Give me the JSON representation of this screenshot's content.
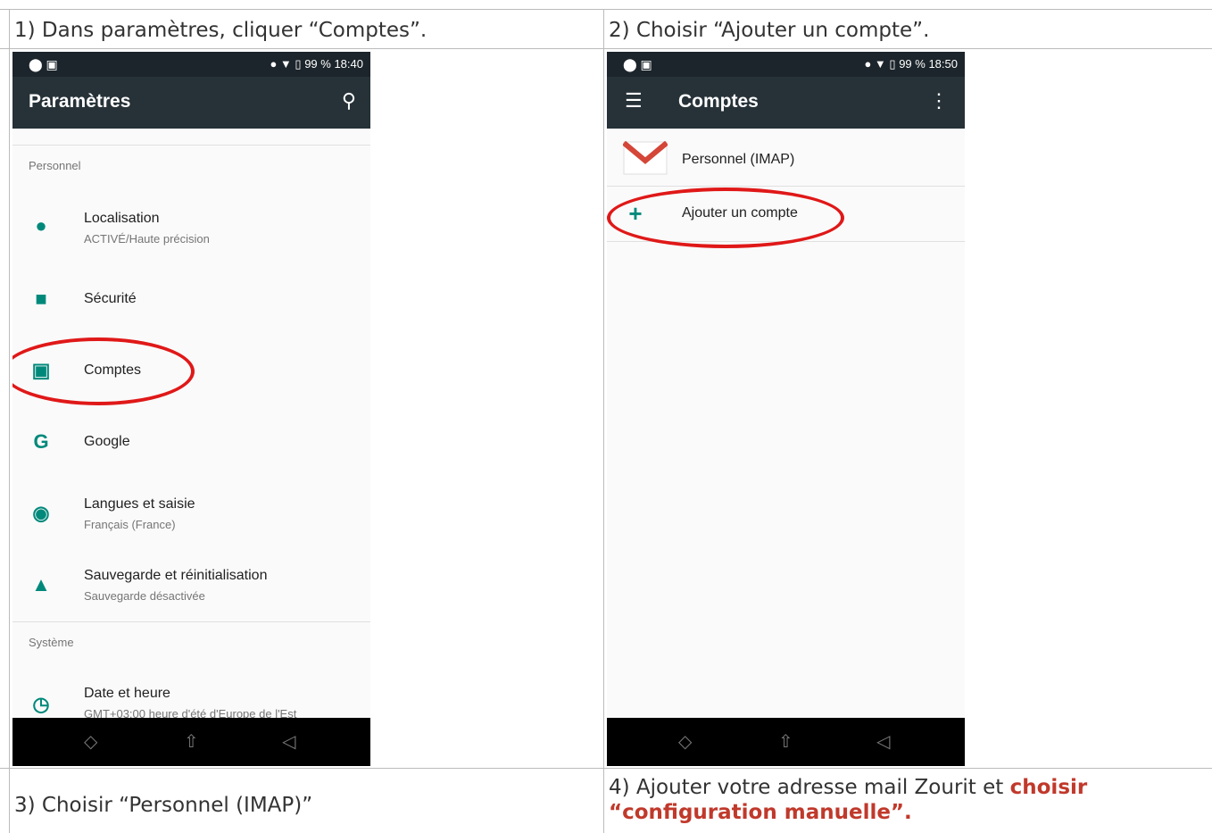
{
  "captions": {
    "step1": "1) Dans paramètres, cliquer “Comptes”.",
    "step2": "2) Choisir “Ajouter un compte”.",
    "step3": "3) Choisir “Personnel (IMAP)”",
    "step4_line1_plain": "4) Ajouter votre adresse mail Zourit et ",
    "step4_line1_bold": "choisir",
    "step4_line2_bold": "“configuration manuelle”."
  },
  "colors": {
    "toolbar": "#263238",
    "accent": "#00897b",
    "highlight_ring": "#e01818",
    "caption_emphasis": "#c0392b"
  },
  "phone1": {
    "status_time": "18:40",
    "battery": "99 %",
    "title": "Paramètres",
    "sections": {
      "personnel": "Personnel",
      "systeme": "Système"
    },
    "items": [
      {
        "icon": "location-pin-icon",
        "title": "Localisation",
        "subtitle": "ACTIVÉ/Haute précision"
      },
      {
        "icon": "lock-icon",
        "title": "Sécurité",
        "subtitle": ""
      },
      {
        "icon": "account-box-icon",
        "title": "Comptes",
        "subtitle": ""
      },
      {
        "icon": "google-icon",
        "title": "Google",
        "subtitle": ""
      },
      {
        "icon": "globe-icon",
        "title": "Langues et saisie",
        "subtitle": "Français (France)"
      },
      {
        "icon": "cloud-upload-icon",
        "title": "Sauvegarde et réinitialisation",
        "subtitle": "Sauvegarde désactivée"
      },
      {
        "icon": "clock-icon",
        "title": "Date et heure",
        "subtitle": "GMT+03:00 heure d'été d'Europe de l'Est"
      }
    ]
  },
  "phone2": {
    "status_time": "18:50",
    "battery": "99 %",
    "title": "Comptes",
    "items": [
      {
        "icon": "gmail-icon",
        "title": "Personnel (IMAP)"
      },
      {
        "icon": "plus-icon",
        "title": "Ajouter un compte"
      }
    ]
  }
}
